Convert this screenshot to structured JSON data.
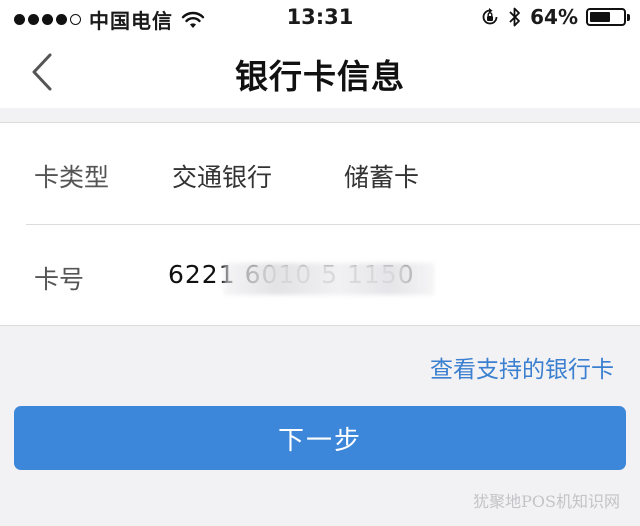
{
  "status_bar": {
    "carrier": "中国电信",
    "time": "13:31",
    "battery_percent": "64%",
    "battery_level": 0.64,
    "signal_bars_filled": 4,
    "signal_bars_total": 5,
    "icons": [
      "signal-dots-icon",
      "wifi-icon",
      "orientation-lock-icon",
      "bluetooth-icon",
      "battery-icon"
    ]
  },
  "nav": {
    "title": "银行卡信息",
    "back_icon": "chevron-left-icon"
  },
  "card_info": {
    "type_row": {
      "label": "卡类型",
      "bank": "交通银行",
      "kind": "储蓄卡"
    },
    "number_row": {
      "label": "卡号",
      "value": "6221 6010 5      1150"
    }
  },
  "support_link": "查看支持的银行卡",
  "next_button": "下一步",
  "watermark": "犹聚地POS机知识网",
  "colors": {
    "accent": "#3d87db",
    "link": "#3a7fd0",
    "background": "#f2f2f4"
  }
}
